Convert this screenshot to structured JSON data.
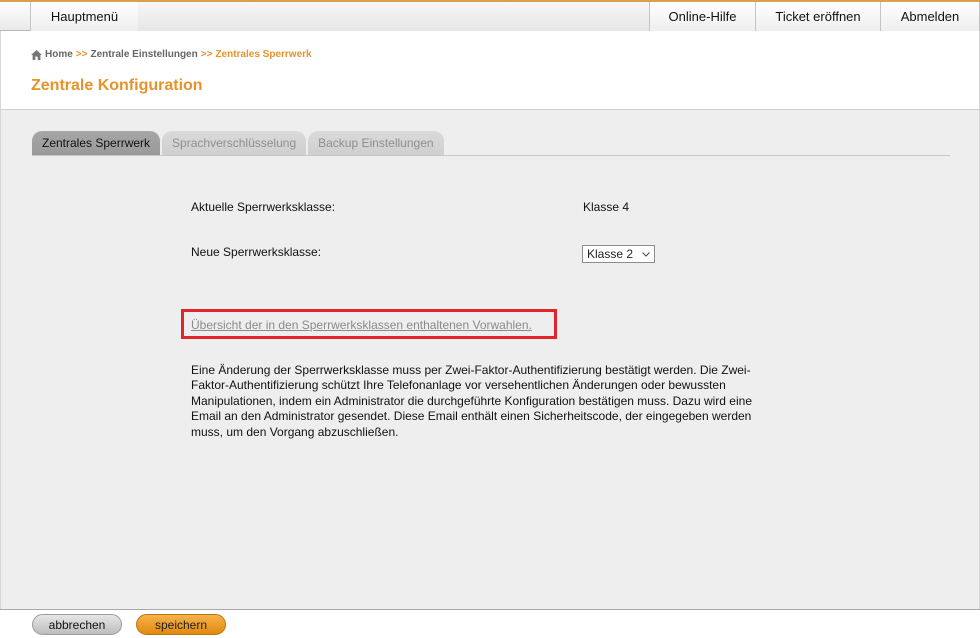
{
  "topbar": {
    "main_menu": "Hauptmenü",
    "online_help": "Online-Hilfe",
    "open_ticket": "Ticket eröffnen",
    "logout": "Abmelden"
  },
  "breadcrumb": {
    "home": "Home",
    "separator": ">>",
    "central_settings": "Zentrale Einstellungen",
    "current": "Zentrales Sperrwerk"
  },
  "page_title": "Zentrale Konfiguration",
  "tabs": [
    {
      "label": "Zentrales Sperrwerk",
      "active": true
    },
    {
      "label": "Sprachverschlüsselung",
      "active": false
    },
    {
      "label": "Backup Einstellungen",
      "active": false
    }
  ],
  "form": {
    "current_label": "Aktuelle Sperrwerksklasse:",
    "current_value": "Klasse 4",
    "new_label": "Neue Sperrwerksklasse:",
    "new_value": "Klasse 2"
  },
  "overview_link": "Übersicht der in den Sperrwerksklassen enthaltenen Vorwahlen.",
  "info_text": "Eine Änderung der Sperrwerksklasse muss per Zwei-Faktor-Authentifizierung bestätigt werden. Die Zwei-Faktor-Authentifizierung schützt Ihre Telefonanlage vor versehentlichen Änderungen oder bewussten Manipulationen, indem ein Administrator die durchgeführte Konfiguration bestätigen muss. Dazu wird eine Email an den Administrator gesendet. Diese Email enthält einen Sicherheitscode, der eingegeben werden muss, um den Vorgang abzuschließen.",
  "footer": {
    "cancel": "abbrechen",
    "save": "speichern"
  },
  "colors": {
    "accent": "#e8922a",
    "highlight": "#e0242b"
  }
}
